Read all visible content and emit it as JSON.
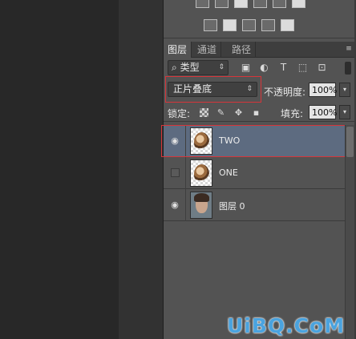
{
  "tabs": [
    "图层",
    "通道",
    "路径"
  ],
  "filter": {
    "kind_label": "类型",
    "select_arrow": "⇕"
  },
  "blend": {
    "mode": "正片叠底",
    "select_arrow": "⇕"
  },
  "opacity": {
    "label": "不透明度:",
    "value": "100%"
  },
  "lock": {
    "label": "锁定:"
  },
  "fill": {
    "label": "填充:",
    "value": "100%"
  },
  "layers": [
    {
      "name": "TWO",
      "visible": true,
      "selected": true
    },
    {
      "name": "ONE",
      "visible": false,
      "selected": false
    },
    {
      "name": "图层 0",
      "visible": true,
      "selected": false
    }
  ],
  "watermark": "UiBQ.CoM",
  "colors": {
    "panel": "#535353",
    "selected_layer": "#5d6b80",
    "highlight_red": "#d6353a",
    "watermark_blue": "#4aa3df"
  },
  "icons": {
    "filter": [
      "search-icon",
      "image-filter-icon",
      "adjustment-filter-icon",
      "type-filter-icon",
      "shape-filter-icon",
      "smart-object-filter-icon"
    ],
    "lock": [
      "lock-transparent-pixels-icon",
      "lock-image-pixels-icon",
      "lock-position-icon",
      "lock-all-icon"
    ],
    "layer_visibility": "eye-icon",
    "panel_menu": "panel-menu-icon"
  }
}
